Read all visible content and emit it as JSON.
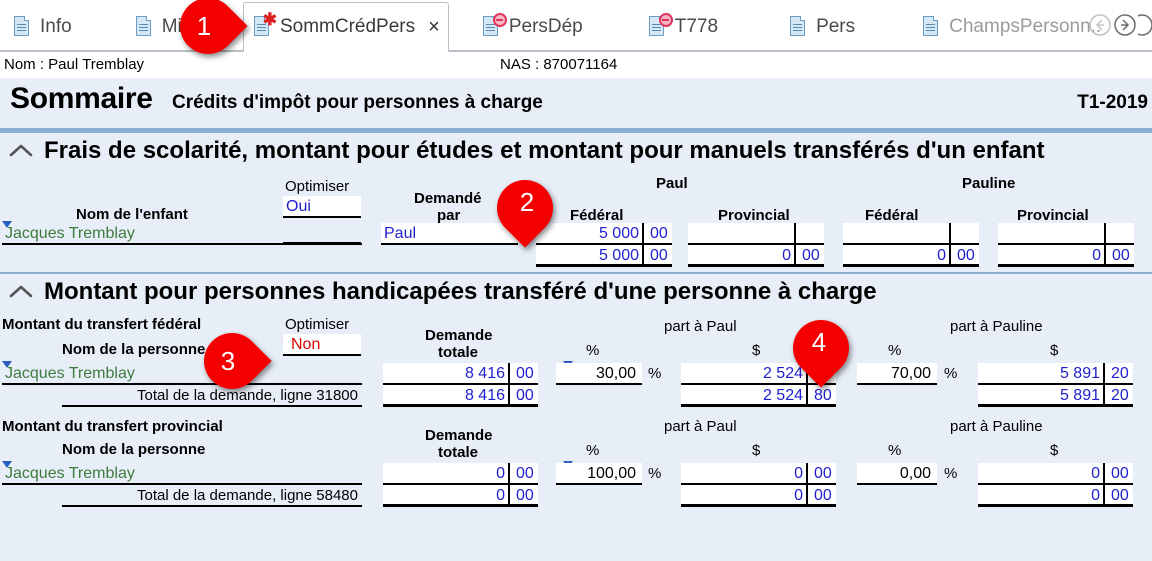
{
  "tabs": [
    {
      "label": "Info",
      "icon": "document-icon",
      "badge": "none",
      "active": false,
      "dim": false
    },
    {
      "label": "Missi",
      "icon": "document-icon",
      "badge": "none",
      "active": false,
      "dim": false
    },
    {
      "label": "SommCrédPers",
      "icon": "document-icon",
      "badge": "asterisk",
      "active": true,
      "dim": false,
      "close": "×"
    },
    {
      "label": "PersDép",
      "icon": "document-icon",
      "badge": "minus",
      "active": false,
      "dim": false
    },
    {
      "label": "T778",
      "icon": "document-icon",
      "badge": "minus",
      "active": false,
      "dim": false
    },
    {
      "label": "Pers",
      "icon": "document-icon",
      "badge": "none",
      "active": false,
      "dim": false
    },
    {
      "label": "ChampsPersonn..",
      "icon": "document-icon",
      "badge": "none",
      "active": false,
      "dim": true
    }
  ],
  "nav": {
    "back": "back-arrow-icon",
    "forward": "forward-arrow-icon"
  },
  "identity": {
    "nom": "Nom : Paul Tremblay",
    "nas": "NAS : 870071164"
  },
  "title": {
    "main": "Sommaire",
    "sub": "Crédits d'impôt pour personnes à charge",
    "year": "T1-2019"
  },
  "section1": {
    "heading": "Frais de scolarité, montant pour études et montant pour manuels transférés d'un enfant",
    "headers": {
      "child_name": "Nom de l'enfant",
      "optimiser": "Optimiser",
      "demande_par_l1": "Demandé",
      "demande_par_l2": "par",
      "paul": "Paul",
      "pauline": "Pauline",
      "federal": "Fédéral",
      "provincial": "Provincial"
    },
    "optimiser_value": "Oui",
    "rows": [
      {
        "name": "Jacques Tremblay",
        "demande_par": "Paul",
        "paul_federal": {
          "dollars": "5 000",
          "cents": "00"
        },
        "paul_provincial": {
          "dollars": "",
          "cents": ""
        },
        "pauline_federal": {
          "dollars": "",
          "cents": ""
        },
        "pauline_provincial": {
          "dollars": "",
          "cents": ""
        }
      }
    ],
    "total": {
      "paul_federal": {
        "dollars": "5 000",
        "cents": "00"
      },
      "paul_provincial": {
        "dollars": "0",
        "cents": "00"
      },
      "pauline_federal": {
        "dollars": "0",
        "cents": "00"
      },
      "pauline_provincial": {
        "dollars": "0",
        "cents": "00"
      }
    }
  },
  "section2": {
    "heading": "Montant pour personnes handicapées transféré d'une personne à charge",
    "federal_block": {
      "title": "Montant du transfert fédéral",
      "name_header": "Nom de la personne",
      "optimiser_label": "Optimiser",
      "optimiser_value": "Non",
      "demande_l1": "Demande",
      "demande_l2": "totale",
      "part_paul": "part à Paul",
      "part_pauline": "part à Pauline",
      "pct_header": "%",
      "dollar_header": "$",
      "row": {
        "name": "Jacques Tremblay",
        "demande_totale": {
          "dollars": "8 416",
          "cents": "00"
        },
        "paul_pct": "30,00",
        "paul_amount": {
          "dollars": "2 524",
          "cents": "80"
        },
        "pauline_pct": "70,00",
        "pauline_amount": {
          "dollars": "5 891",
          "cents": "20"
        }
      },
      "total_label": "Total de la demande, ligne 31800",
      "total": {
        "demande_totale": {
          "dollars": "8 416",
          "cents": "00"
        },
        "paul_amount": {
          "dollars": "2 524",
          "cents": "80"
        },
        "pauline_amount": {
          "dollars": "5 891",
          "cents": "20"
        }
      }
    },
    "provincial_block": {
      "title": "Montant du transfert provincial",
      "name_header": "Nom de la personne",
      "demande_l1": "Demande",
      "demande_l2": "totale",
      "part_paul": "part à Paul",
      "part_pauline": "part à Pauline",
      "pct_header": "%",
      "dollar_header": "$",
      "row": {
        "name": "Jacques Tremblay",
        "demande_totale": {
          "dollars": "0",
          "cents": "00"
        },
        "paul_pct": "100,00",
        "paul_amount": {
          "dollars": "0",
          "cents": "00"
        },
        "pauline_pct": "0,00",
        "pauline_amount": {
          "dollars": "0",
          "cents": "00"
        }
      },
      "total_label": "Total de la demande, ligne 58480",
      "total": {
        "demande_totale": {
          "dollars": "0",
          "cents": "00"
        },
        "paul_amount": {
          "dollars": "0",
          "cents": "00"
        },
        "pauline_amount": {
          "dollars": "0",
          "cents": "00"
        }
      }
    }
  },
  "callouts": [
    {
      "number": "1"
    },
    {
      "number": "2"
    },
    {
      "number": "3"
    },
    {
      "number": "4"
    }
  ],
  "percent_sign": "%",
  "colors": {
    "accent_blue": "#8aadd6",
    "sheet_bg": "#e8eef8",
    "value_blue": "#2020d0",
    "name_green": "#3d7a3d",
    "warn_red": "#d40000",
    "callout_red": "#f50000"
  }
}
